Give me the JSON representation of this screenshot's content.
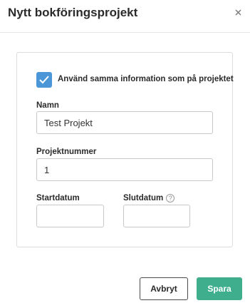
{
  "dialog": {
    "title": "Nytt bokföringsprojekt"
  },
  "form": {
    "same_info_checkbox": {
      "label": "Använd samma information som på projektet",
      "checked": true,
      "color": "#4a96d6"
    },
    "name": {
      "label": "Namn",
      "value": "Test Projekt"
    },
    "project_number": {
      "label": "Projektnummer",
      "value": "1"
    },
    "start_date": {
      "label": "Startdatum",
      "value": ""
    },
    "end_date": {
      "label": "Slutdatum",
      "value": "",
      "help_glyph": "?"
    }
  },
  "footer": {
    "cancel_label": "Avbryt",
    "save_label": "Spara",
    "save_color": "#3fae8c"
  }
}
